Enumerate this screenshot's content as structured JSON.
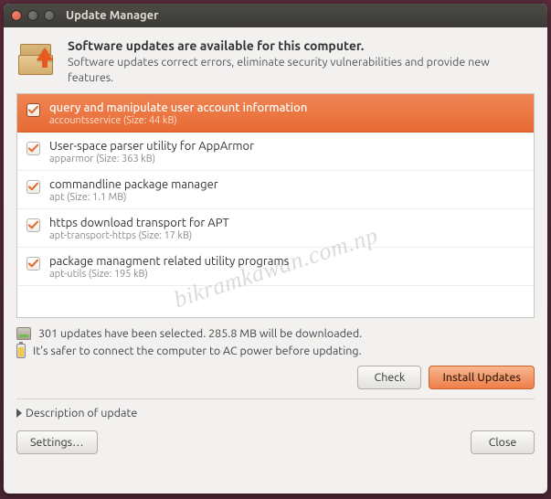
{
  "window": {
    "title": "Update Manager"
  },
  "header": {
    "heading": "Software updates are available for this computer.",
    "sub": "Software updates correct errors, eliminate security vulnerabilities and provide new features."
  },
  "updates": [
    {
      "title": "query and manipulate user account information",
      "sub": "accountsservice (Size: 44 kB)",
      "selected": true
    },
    {
      "title": "User-space parser utility for AppArmor",
      "sub": "apparmor (Size: 363 kB)",
      "selected": false
    },
    {
      "title": "commandline package manager",
      "sub": "apt (Size: 1.1 MB)",
      "selected": false
    },
    {
      "title": "https download transport for APT",
      "sub": "apt-transport-https (Size: 17 kB)",
      "selected": false
    },
    {
      "title": "package managment related utility programs",
      "sub": "apt-utils (Size: 195 kB)",
      "selected": false
    }
  ],
  "status": {
    "count_line": "301 updates have been selected. 285.8 MB will be downloaded.",
    "power_line": "It's safer to connect the computer to AC power before updating."
  },
  "buttons": {
    "check": "Check",
    "install": "Install Updates",
    "settings": "Settings…",
    "close": "Close"
  },
  "expander": {
    "label": "Description of update"
  },
  "watermark": "bikramkawan.com.np"
}
